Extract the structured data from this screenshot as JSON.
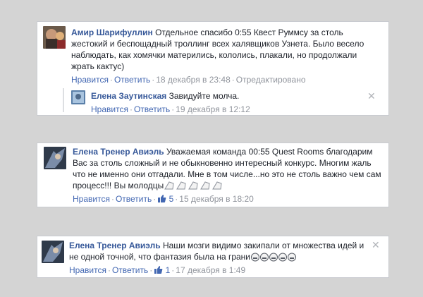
{
  "comments": [
    {
      "author": "Амир Шарифуллин",
      "text": "Отдельное спасибо 0:55 Квест Руммсу за столь жестокий и беспощадный троллинг всех халявщиков Узнета. Было весело наблюдать, как хомячки матерились, кололись, плакали, но продолжали жрать кактус)",
      "like_label": "Нравится",
      "reply_label": "Ответить",
      "timestamp": "18 декабря в 23:48",
      "edited_label": "Отредактировано",
      "reply": {
        "author": "Елена Заутинская",
        "text": "Завидуйте молча.",
        "like_label": "Нравится",
        "reply_label": "Ответить",
        "timestamp": "19 декабря в 12:12"
      }
    },
    {
      "author": "Елена Тренер Авиэль",
      "text": "Уважаемая команда 00:55 Quest Rooms благодарим Вас за столь сложный и не обыкновенно интересный конкурс. Многим жаль что не именно они отгадали. Мне в том числе...но это не столь важно чем сам процесс!!! Вы молодцы",
      "like_label": "Нравится",
      "reply_label": "Ответить",
      "like_count": "5",
      "timestamp": "15 декабря в 18:20"
    },
    {
      "author": "Елена Тренер Авиэль",
      "text": "Наши мозги видимо закипали от множества идей и не одной точной, что фантазия была на грани",
      "like_label": "Нравится",
      "reply_label": "Ответить",
      "like_count": "1",
      "timestamp": "17 декабря в 1:49"
    }
  ],
  "icons": {
    "close": "close-icon",
    "like": "thumbs-up-icon",
    "emoji_1": "clapping-emoji",
    "emoji_2": "grimacing-emoji"
  },
  "colors": {
    "link": "#365899",
    "action": "#4267b2",
    "meta": "#90949c",
    "background": "#d4d4d4"
  }
}
